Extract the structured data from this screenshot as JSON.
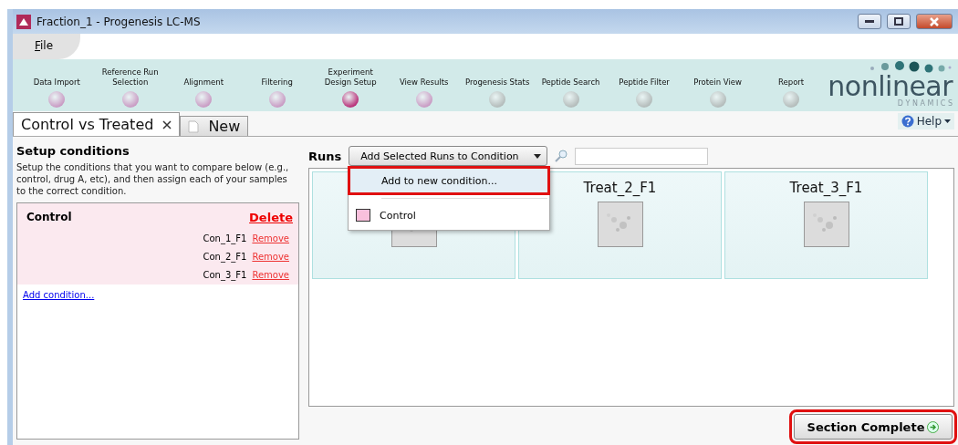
{
  "window": {
    "title": "Fraction_1 - Progenesis LC-MS"
  },
  "menu": [
    {
      "label": "File"
    }
  ],
  "steps": [
    {
      "label": "Data Import",
      "completed": true,
      "selected": false
    },
    {
      "label": "Reference Run Selection",
      "completed": true,
      "selected": false
    },
    {
      "label": "Alignment",
      "completed": true,
      "selected": false
    },
    {
      "label": "Filtering",
      "completed": true,
      "selected": false
    },
    {
      "label": "Experiment Design Setup",
      "selected": true
    },
    {
      "label": "View Results",
      "completed": true,
      "selected": false
    },
    {
      "label": "Progenesis Stats",
      "completed": false,
      "selected": false
    },
    {
      "label": "Peptide Search",
      "completed": false,
      "selected": false
    },
    {
      "label": "Peptide Filter",
      "completed": false,
      "selected": false
    },
    {
      "label": "Protein View",
      "completed": false,
      "selected": false
    },
    {
      "label": "Report",
      "completed": false,
      "selected": false
    }
  ],
  "logo": {
    "name": "nonlinear",
    "tagline": "D Y N A M I C S"
  },
  "tabs": [
    {
      "label": "Control vs Treated",
      "selected": true,
      "closable": true
    },
    {
      "label": "New",
      "selected": false,
      "closable": false
    }
  ],
  "help": "Help",
  "setup": {
    "title": "Setup conditions",
    "description": "Setup the conditions that you want to compare below (e.g., control, drug A, etc), and then assign each of your samples to the correct condition.",
    "conditions": [
      {
        "name": "Control",
        "delete": "Delete",
        "color": "#fbe9ef",
        "runs": [
          {
            "name": "Con_1_F1",
            "action": "Remove"
          },
          {
            "name": "Con_2_F1",
            "action": "Remove"
          },
          {
            "name": "Con_3_F1",
            "action": "Remove"
          }
        ]
      }
    ],
    "add_link": "Add condition..."
  },
  "runs": {
    "label": "Runs",
    "dropdown": "Add Selected Runs to Condition",
    "menu": [
      {
        "kind": "action",
        "label": "Add to new condition...",
        "highlighted": true
      },
      {
        "kind": "condition",
        "label": "Control",
        "color": "#f9c0dc",
        "highlighted": false
      }
    ],
    "cards": [
      {
        "kind": "picture"
      },
      {
        "name": "Treat_2_F1",
        "kind": "picture"
      },
      {
        "name": "Treat_3_F1",
        "kind": "picture"
      }
    ]
  },
  "complete": {
    "label": "Section Complete",
    "highlighted": true
  }
}
